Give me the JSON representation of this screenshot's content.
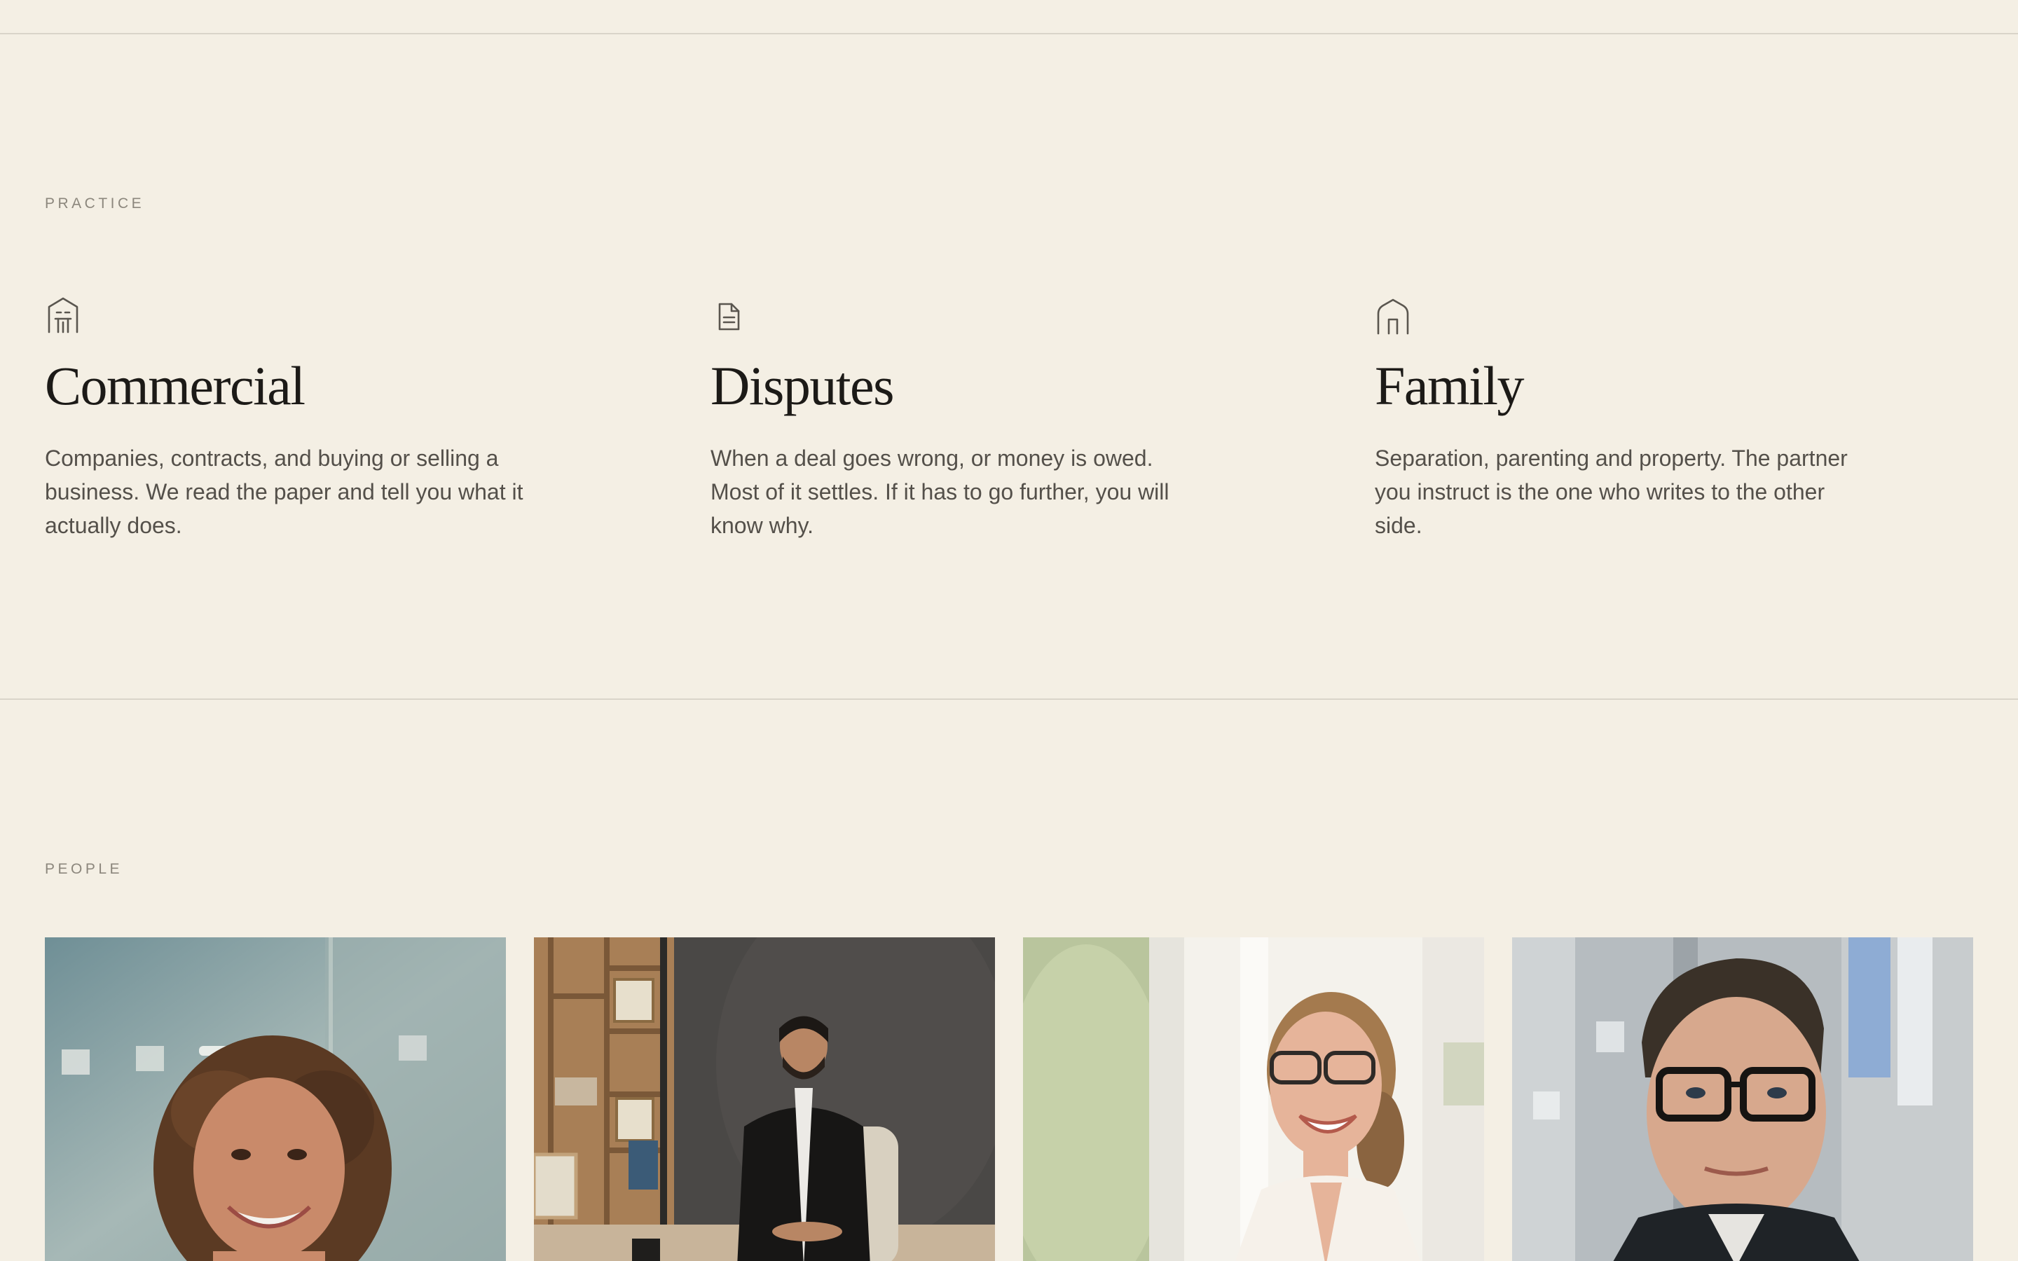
{
  "sections": {
    "practice": {
      "eyebrow": "PRACTICE",
      "items": [
        {
          "icon": "building-icon",
          "title": "Commercial",
          "description": "Companies, contracts, and buying or selling a business. We read the paper and tell you what it actually does."
        },
        {
          "icon": "document-icon",
          "title": "Disputes",
          "description": "When a deal goes wrong, or money is owed. Most of it settles. If it has to go further, you will know why."
        },
        {
          "icon": "house-icon",
          "title": "Family",
          "description": "Separation, parenting and property. The partner you instruct is the one who writes to the other side."
        }
      ]
    },
    "people": {
      "eyebrow": "PEOPLE",
      "portraits": [
        {
          "subject": "curly-haired woman smiling in office"
        },
        {
          "subject": "bearded man in black suit seated in office"
        },
        {
          "subject": "woman with glasses laughing"
        },
        {
          "subject": "man with glasses in dark jacket"
        }
      ]
    }
  },
  "colors": {
    "background": "#f4efe4",
    "rule": "#d9d4c9",
    "heading": "#1c1a17",
    "body": "#54504a",
    "eyebrow": "#8c877d",
    "icon": "#5a564f"
  }
}
